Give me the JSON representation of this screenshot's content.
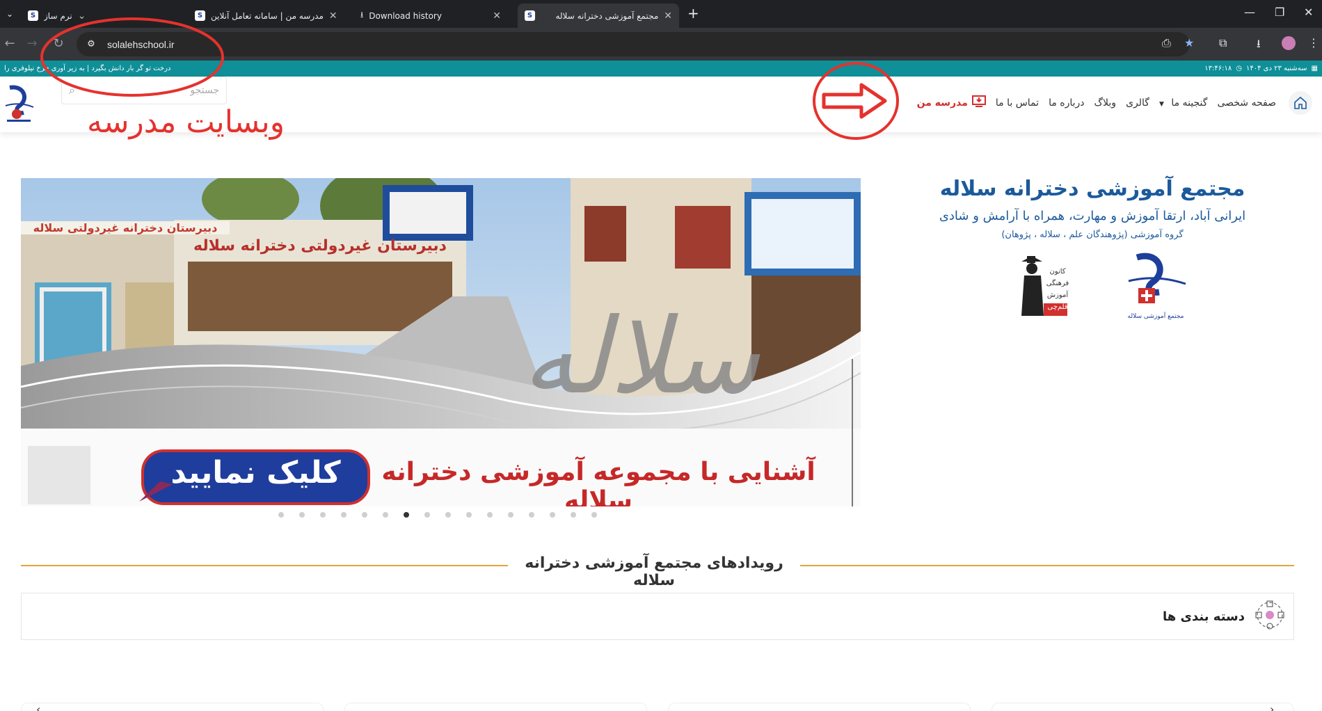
{
  "browser": {
    "tabs": [
      {
        "title": "نرم ساز",
        "active": false
      },
      {
        "title": "مدرسه من | سامانه تعامل آنلاین",
        "active": false
      },
      {
        "title": "Download history",
        "active": false
      },
      {
        "title": "مجتمع آموزشی دخترانه سلاله",
        "active": true
      }
    ],
    "url": "solalehschool.ir"
  },
  "topbar": {
    "left_text": "درخت تو گر بار دانش بگیرد | به زیر آوری چرخ نیلوفری را",
    "date_text": "سه‌شنبه ۲۳ دی ۱۴۰۴",
    "time_text": "۱۳:۴۶:۱۸"
  },
  "header": {
    "search_placeholder": "جستجو",
    "nav": {
      "home": "صفحه شخصی",
      "treasure": "گنجینه ما",
      "gallery": "گالری",
      "blog": "وبلاگ",
      "about": "درباره ما",
      "contact": "تماس با ما",
      "my_school": "مدرسه من"
    }
  },
  "annotation": {
    "label": "وبسایت مدرسه",
    "color": "#e5322d"
  },
  "intro": {
    "title": "مجتمع آموزشی دخترانه سلاله",
    "subtitle": "ایرانی آباد، ارتقا آموزش و مهارت، همراه با آرامش و شادی",
    "group": "گروه آموزشی (پژوهندگان علم ، سلاله ، پژوهان)",
    "kanoon_lines": [
      "کانون",
      "فرهنگی",
      "آموزش",
      "قلم‌چی"
    ],
    "solaleh_logo_text": "مجتمع آموزشی سلاله"
  },
  "slider": {
    "banner_big_word": "سلاله",
    "sign_school_name": "دبیرستان دخترانه غیردولتی سلاله",
    "sign_front": "دبیرستان غیردولتی دخترانه سلاله",
    "caption": "آشنایی با مجموعه آموزشی دخترانه سلاله",
    "cta": "کلیک نمایید",
    "dot_count": 16,
    "active_dot": 7
  },
  "events": {
    "title": "رویدادهای مجتمع آموزشی دخترانه سلاله",
    "categories_label": "دسته بندی ها"
  },
  "colors": {
    "teal_bar": "#0f8f98",
    "brand_blue": "#1b5a9b",
    "accent_red": "#d0302e",
    "section_line": "#e2a53a"
  }
}
